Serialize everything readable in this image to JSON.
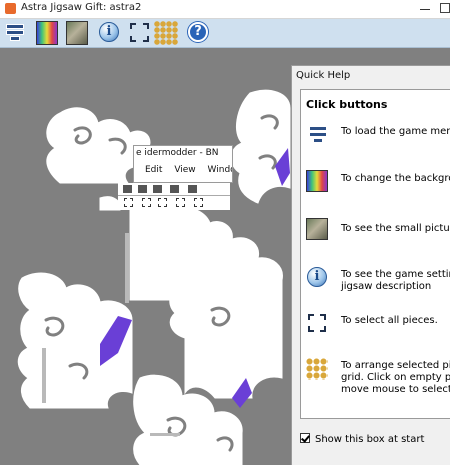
{
  "window": {
    "title": "Astra Jigsaw Gift: astra2"
  },
  "toolbar": {
    "buttons": [
      {
        "icon": "menu-icon",
        "tooltip": "Load the game menu"
      },
      {
        "icon": "background-icon"
      },
      {
        "icon": "picture-icon"
      },
      {
        "icon": "info-icon"
      },
      {
        "icon": "select-all-icon"
      },
      {
        "icon": "arrange-icon"
      },
      {
        "icon": "help-icon"
      }
    ]
  },
  "quick_help": {
    "title": "Quick Help",
    "heading": "Click buttons",
    "items": [
      {
        "icon": "menu-icon",
        "text": "To load the game men"
      },
      {
        "icon": "background-icon",
        "text": "To change the backgro"
      },
      {
        "icon": "picture-icon",
        "text": "To see the small pictur"
      },
      {
        "icon": "info-icon",
        "text": "To see the game settin\njigsaw description"
      },
      {
        "icon": "select-all-icon",
        "text": "To select all pieces."
      },
      {
        "icon": "arrange-icon",
        "text": "To arrange selected pi\ngrid. Click on empty ple\nmove mouse to select"
      }
    ],
    "show_at_start_label": "Show this box at start",
    "show_at_start_checked": true
  },
  "puzzle_fragment": {
    "title": "e    idermodder - BN",
    "menu": [
      "Edit",
      "View",
      "Window"
    ]
  },
  "colors": {
    "desktop": "#808080",
    "toolbar": "#cfe0ef",
    "piece": "#ffffff",
    "accent_purple": "#6a3fd6"
  }
}
